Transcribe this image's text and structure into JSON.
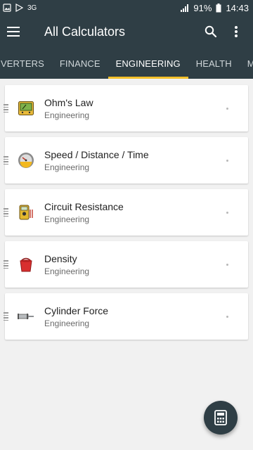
{
  "status_bar": {
    "battery": "91%",
    "time": "14:43",
    "signal_text": "3G"
  },
  "toolbar": {
    "title": "All Calculators"
  },
  "tabs": [
    {
      "label": "VERTERS"
    },
    {
      "label": "FINANCE"
    },
    {
      "label": "ENGINEERING",
      "active": true
    },
    {
      "label": "HEALTH"
    },
    {
      "label": "MISCELLA"
    }
  ],
  "calculators": [
    {
      "name": "Ohm's Law",
      "category": "Engineering",
      "icon": "multimeter-display-icon"
    },
    {
      "name": "Speed / Distance / Time",
      "category": "Engineering",
      "icon": "speedometer-icon"
    },
    {
      "name": "Circuit Resistance",
      "category": "Engineering",
      "icon": "multimeter-icon"
    },
    {
      "name": "Density",
      "category": "Engineering",
      "icon": "red-bucket-icon"
    },
    {
      "name": "Cylinder Force",
      "category": "Engineering",
      "icon": "cylinder-icon"
    }
  ],
  "colors": {
    "bar": "#2f3e45",
    "accent": "#f3c02a",
    "background": "#f1f1f1"
  }
}
